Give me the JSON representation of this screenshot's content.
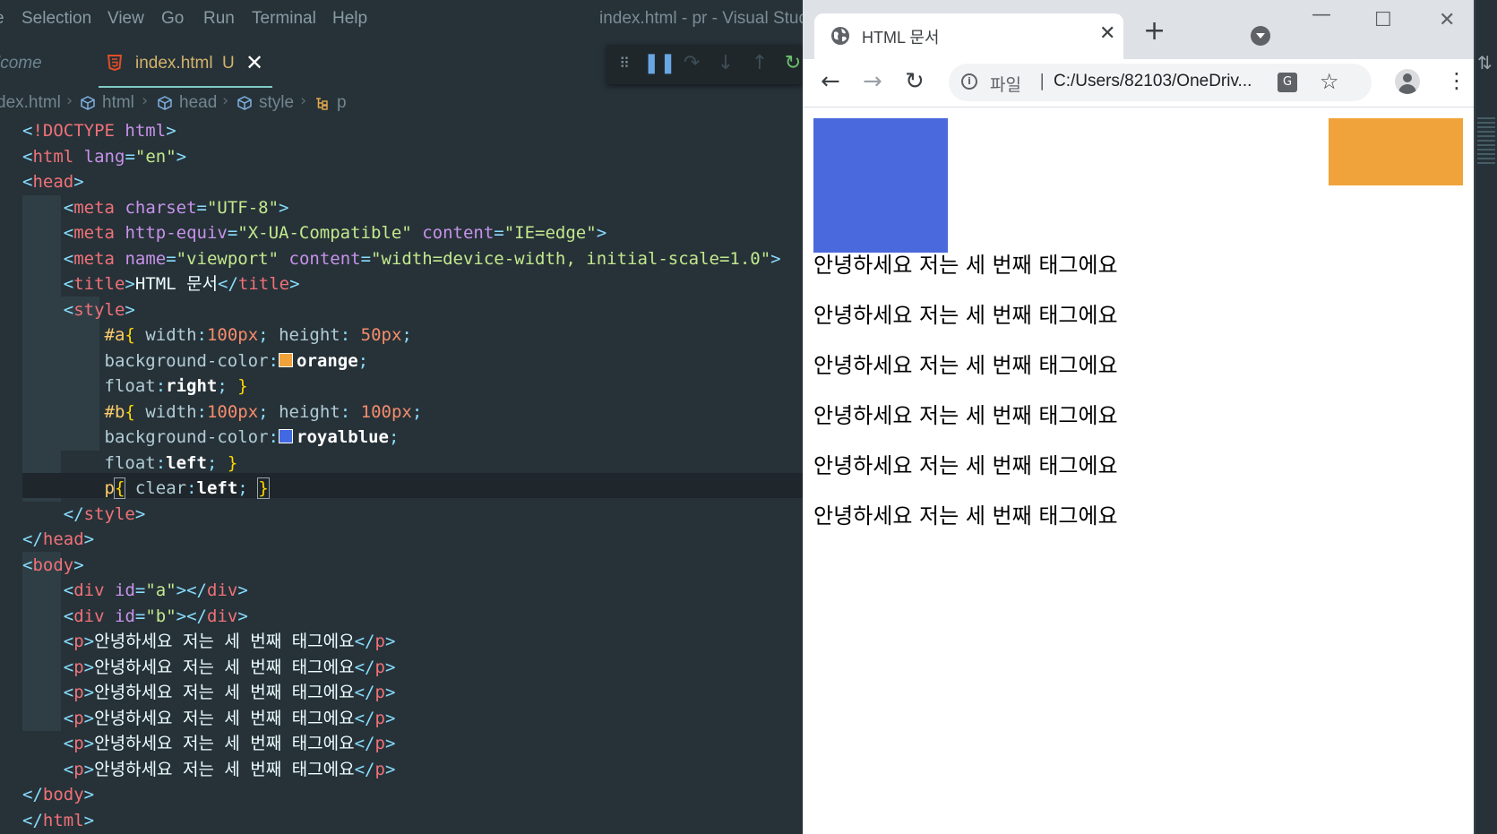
{
  "vscode": {
    "menu_lead": "e",
    "menu": [
      "Selection",
      "View",
      "Go",
      "Run",
      "Terminal",
      "Help"
    ],
    "window_title": "index.html - pr - Visual Studi",
    "tabs": {
      "welcome": "lcome",
      "active": "index.html",
      "active_status": "U"
    },
    "breadcrumb": [
      "dex.html",
      "html",
      "head",
      "style",
      "p"
    ],
    "code_lines": [
      "<!DOCTYPE html>",
      "<html lang=\"en\">",
      "<head>",
      "<meta charset=\"UTF-8\">",
      "<meta http-equiv=\"X-UA-Compatible\" content=\"IE=edge\">",
      "<meta name=\"viewport\" content=\"width=device-width, initial-scale=1.0\">",
      "<title>HTML 문서</title>",
      "<style>",
      "#a{ width:100px; height: 50px;",
      "background-color: orange;",
      "float:right; }",
      "#b{ width:100px; height: 100px;",
      "background-color: royalblue;",
      "float:left; }",
      "p{ clear:left; }",
      "</style>",
      "</head>",
      "<body>",
      "<div id=\"a\"></div>",
      "<div id=\"b\"></div>",
      "<p>안녕하세요 저는 세 번째 태그에요</p>",
      "<p>안녕하세요 저는 세 번째 태그에요</p>",
      "<p>안녕하세요 저는 세 번째 태그에요</p>",
      "<p>안녕하세요 저는 세 번째 태그에요</p>",
      "<p>안녕하세요 저는 세 번째 태그에요</p>",
      "<p>안녕하세요 저는 세 번째 태그에요</p>",
      "</body>",
      "</html>"
    ],
    "colors": {
      "editor_bg": "#263238",
      "tag": "#f07178",
      "attribute": "#c792ea",
      "string": "#c3e88d",
      "number": "#f78c6c",
      "selector": "#ffcb6b",
      "orange_swatch": "#f0a33a",
      "royalblue_swatch": "#4169e1"
    }
  },
  "chrome": {
    "tab_title": "HTML 문서",
    "omnibox": {
      "scheme_label": "파일",
      "url": "C:/Users/82103/OneDriv..."
    },
    "page": {
      "box_a_color": "#f0a33a",
      "box_b_color": "#4a69dc",
      "paragraphs": [
        "안녕하세요 저는 세 번째 태그에요",
        "안녕하세요 저는 세 번째 태그에요",
        "안녕하세요 저는 세 번째 태그에요",
        "안녕하세요 저는 세 번째 태그에요",
        "안녕하세요 저는 세 번째 태그에요",
        "안녕하세요 저는 세 번째 태그에요"
      ]
    }
  }
}
